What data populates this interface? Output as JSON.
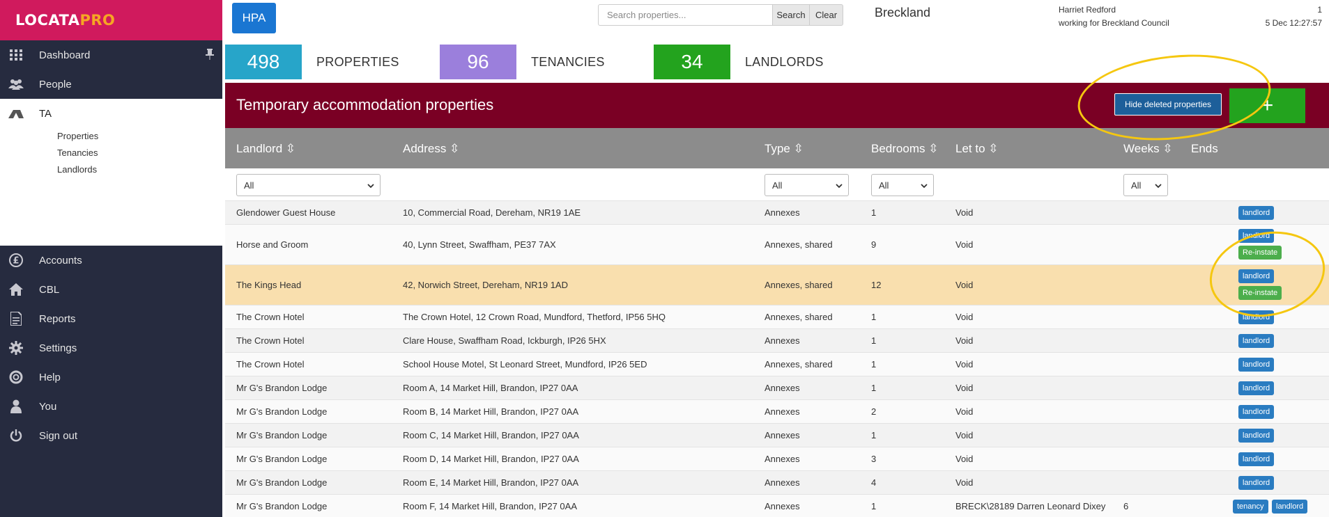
{
  "logo": {
    "main": "LOCATA",
    "pro": "PRO"
  },
  "sidebar": {
    "items": [
      {
        "label": "Dashboard",
        "icon": "grid-icon"
      },
      {
        "label": "People",
        "icon": "people-icon"
      },
      {
        "label": "TA",
        "icon": "tent-icon"
      },
      {
        "label": "Accounts",
        "icon": "pound-icon"
      },
      {
        "label": "CBL",
        "icon": "home-icon"
      },
      {
        "label": "Reports",
        "icon": "document-icon"
      },
      {
        "label": "Settings",
        "icon": "gear-icon"
      },
      {
        "label": "Help",
        "icon": "lifebuoy-icon"
      },
      {
        "label": "You",
        "icon": "user-icon"
      },
      {
        "label": "Sign out",
        "icon": "power-icon"
      }
    ],
    "ta_sub": [
      "Properties",
      "Tenancies",
      "Landlords"
    ]
  },
  "topbar": {
    "hpa": "HPA",
    "search_placeholder": "Search properties...",
    "search_label": "Search",
    "clear_label": "Clear",
    "org": "Breckland",
    "user": "Harriet Redford",
    "working_for": "working for Breckland Council",
    "count": "1",
    "datetime": "5 Dec 12:27:57"
  },
  "stats": [
    {
      "value": "498",
      "label": "PROPERTIES",
      "color": "#27a5c9"
    },
    {
      "value": "96",
      "label": "TENANCIES",
      "color": "#9b7fdc"
    },
    {
      "value": "34",
      "label": "LANDLORDS",
      "color": "#23a31e"
    }
  ],
  "panel": {
    "title": "Temporary accommodation properties",
    "hide_deleted": "Hide deleted properties",
    "add": "+"
  },
  "table": {
    "headers": {
      "landlord": "Landlord ⇳",
      "address": "Address ⇳",
      "type": "Type ⇳",
      "bedrooms": "Bedrooms ⇳",
      "let_to": "Let to ⇳",
      "weeks": "Weeks ⇳",
      "ends": "Ends"
    },
    "filters": {
      "landlord": "All",
      "type": "All",
      "bedrooms": "All",
      "weeks": "All"
    },
    "rows": [
      {
        "landlord": "Glendower Guest House",
        "address": "10, Commercial Road, Dereham, NR19 1AE",
        "type": "Annexes",
        "bedrooms": "1",
        "let_to": "Void",
        "weeks": "",
        "badges": [
          "landlord"
        ]
      },
      {
        "landlord": "Horse and Groom",
        "address": "40, Lynn Street, Swaffham, PE37 7AX",
        "type": "Annexes, shared",
        "bedrooms": "9",
        "let_to": "Void",
        "weeks": "",
        "badges": [
          "landlord",
          "Re-instate"
        ]
      },
      {
        "landlord": "The Kings Head",
        "address": "42, Norwich Street, Dereham, NR19 1AD",
        "type": "Annexes, shared",
        "bedrooms": "12",
        "let_to": "Void",
        "weeks": "",
        "badges": [
          "landlord",
          "Re-instate"
        ]
      },
      {
        "landlord": "The Crown Hotel",
        "address": "The Crown Hotel, 12 Crown Road, Mundford, Thetford, IP56 5HQ",
        "type": "Annexes, shared",
        "bedrooms": "1",
        "let_to": "Void",
        "weeks": "",
        "badges": [
          "landlord"
        ]
      },
      {
        "landlord": "The Crown Hotel",
        "address": "Clare House, Swaffham Road, Ickburgh, IP26 5HX",
        "type": "Annexes",
        "bedrooms": "1",
        "let_to": "Void",
        "weeks": "",
        "badges": [
          "landlord"
        ]
      },
      {
        "landlord": "The Crown Hotel",
        "address": "School House Motel, St Leonard Street, Mundford, IP26 5ED",
        "type": "Annexes, shared",
        "bedrooms": "1",
        "let_to": "Void",
        "weeks": "",
        "badges": [
          "landlord"
        ]
      },
      {
        "landlord": "Mr G's Brandon Lodge",
        "address": "Room A, 14 Market Hill, Brandon, IP27 0AA",
        "type": "Annexes",
        "bedrooms": "1",
        "let_to": "Void",
        "weeks": "",
        "badges": [
          "landlord"
        ]
      },
      {
        "landlord": "Mr G's Brandon Lodge",
        "address": "Room B, 14 Market Hill, Brandon, IP27 0AA",
        "type": "Annexes",
        "bedrooms": "2",
        "let_to": "Void",
        "weeks": "",
        "badges": [
          "landlord"
        ]
      },
      {
        "landlord": "Mr G's Brandon Lodge",
        "address": "Room C, 14 Market Hill, Brandon, IP27 0AA",
        "type": "Annexes",
        "bedrooms": "1",
        "let_to": "Void",
        "weeks": "",
        "badges": [
          "landlord"
        ]
      },
      {
        "landlord": "Mr G's Brandon Lodge",
        "address": "Room D, 14 Market Hill, Brandon, IP27 0AA",
        "type": "Annexes",
        "bedrooms": "3",
        "let_to": "Void",
        "weeks": "",
        "badges": [
          "landlord"
        ]
      },
      {
        "landlord": "Mr G's Brandon Lodge",
        "address": "Room E, 14 Market Hill, Brandon, IP27 0AA",
        "type": "Annexes",
        "bedrooms": "4",
        "let_to": "Void",
        "weeks": "",
        "badges": [
          "landlord"
        ]
      },
      {
        "landlord": "Mr G's Brandon Lodge",
        "address": "Room F, 14 Market Hill, Brandon, IP27 0AA",
        "type": "Annexes",
        "bedrooms": "1",
        "let_to": "BRECK\\28189 Darren Leonard Dixey",
        "weeks": "6",
        "badges": [
          "tenancy",
          "landlord"
        ]
      }
    ]
  },
  "colors": {
    "logo_bg": "#d01a5d",
    "sidebar_bg": "#262b3f",
    "panel_bg": "#7a0024",
    "header_grey": "#8c8c8c",
    "highlight_row": "#f9dfae",
    "annotation": "#f5c710"
  }
}
